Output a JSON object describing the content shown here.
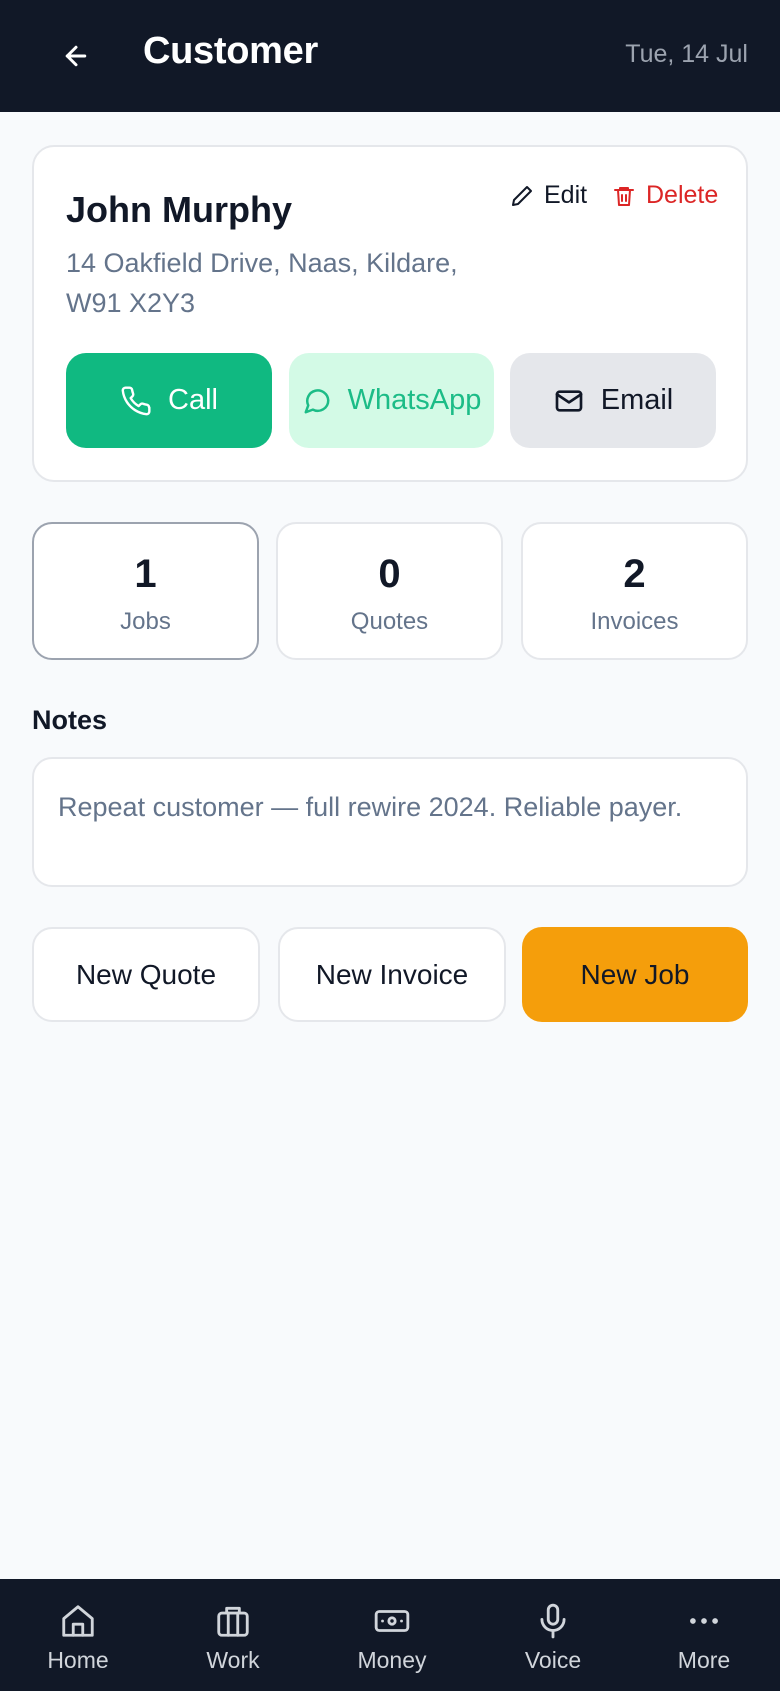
{
  "header": {
    "title": "Customer",
    "date": "Tue, 14 Jul"
  },
  "customer": {
    "name": "John Murphy",
    "address_line1": "14 Oakfield Drive, Naas, Kildare,",
    "address_line2": "W91 X2Y3",
    "edit_label": "Edit",
    "delete_label": "Delete"
  },
  "contact_actions": {
    "call": "Call",
    "whatsapp": "WhatsApp",
    "email": "Email"
  },
  "stats": [
    {
      "value": "1",
      "label": "Jobs"
    },
    {
      "value": "0",
      "label": "Quotes"
    },
    {
      "value": "2",
      "label": "Invoices"
    }
  ],
  "notes": {
    "heading": "Notes",
    "text": "Repeat customer — full rewire 2024. Reliable payer."
  },
  "actions": {
    "new_quote": "New Quote",
    "new_invoice": "New Invoice",
    "new_job": "New Job"
  },
  "nav": [
    {
      "label": "Home",
      "icon": "home-icon"
    },
    {
      "label": "Work",
      "icon": "briefcase-icon"
    },
    {
      "label": "Money",
      "icon": "banknote-icon"
    },
    {
      "label": "Voice",
      "icon": "microphone-icon"
    },
    {
      "label": "More",
      "icon": "more-icon"
    }
  ],
  "colors": {
    "header_bg": "#111827",
    "call_green": "#10b981",
    "whatsapp_bg": "#d1fae5",
    "delete_red": "#dc2626",
    "new_job_amber": "#f59e0b"
  }
}
